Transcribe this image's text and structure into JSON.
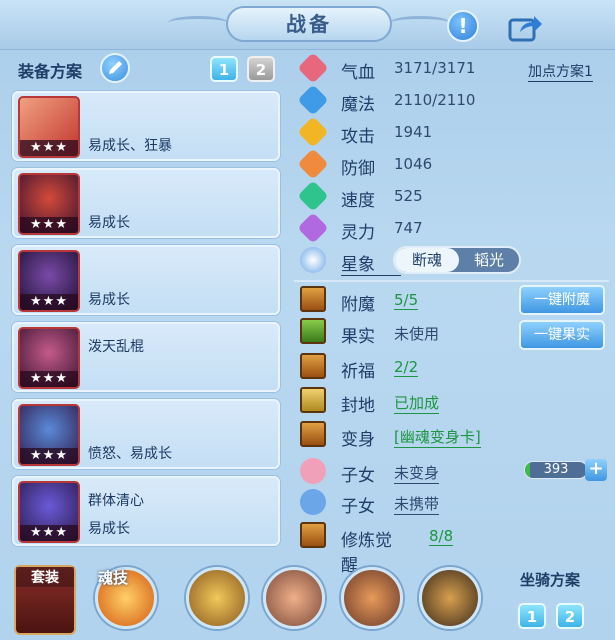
{
  "title": "战备",
  "left": {
    "plan_label": "装备方案",
    "plan_tabs": [
      "1",
      "2"
    ],
    "equipment": [
      {
        "line1": "",
        "line2": "易成长、狂暴",
        "stars": "★★★",
        "color": "#e25c3f"
      },
      {
        "line1": "",
        "line2": "易成长",
        "stars": "★★★",
        "color": "#b3364a"
      },
      {
        "line1": "",
        "line2": "易成长",
        "stars": "★★★",
        "color": "#5e2a6a"
      },
      {
        "line1": "泼天乱棍",
        "line2": "",
        "stars": "★★★",
        "color": "#7a2e56"
      },
      {
        "line1": "",
        "line2": "愤怒、易成长",
        "stars": "★★★",
        "color": "#3a5f9a"
      },
      {
        "line1": "群体清心",
        "line2": "易成长",
        "stars": "★★★",
        "color": "#4a3a9a"
      }
    ]
  },
  "stats": [
    {
      "label": "气血",
      "value": "3171/3171",
      "icon": "heart-icon",
      "color": "#e8677d"
    },
    {
      "label": "魔法",
      "value": "2110/2110",
      "icon": "mana-icon",
      "color": "#3f9be8"
    },
    {
      "label": "攻击",
      "value": "1941",
      "icon": "sword-icon",
      "color": "#f2b523"
    },
    {
      "label": "防御",
      "value": "1046",
      "icon": "shield-icon",
      "color": "#f08a3c"
    },
    {
      "label": "速度",
      "value": "525",
      "icon": "speed-icon",
      "color": "#2fc48d"
    },
    {
      "label": "灵力",
      "value": "747",
      "icon": "spirit-icon",
      "color": "#b069e0"
    }
  ],
  "add_point": "加点方案1",
  "star": {
    "label": "星象",
    "toggle_on": "断魂",
    "toggle_off": "韬光"
  },
  "features": [
    {
      "label": "附魔",
      "value": "5/5"
    },
    {
      "label": "果实",
      "value": "未使用"
    },
    {
      "label": "祈福",
      "value": "2/2"
    },
    {
      "label": "封地",
      "value": "已加成"
    },
    {
      "label": "变身",
      "value": "[幽魂变身卡]"
    },
    {
      "label": "子女",
      "value": "未变身"
    },
    {
      "label": "子女",
      "value": "未携带"
    },
    {
      "label": "修炼觉醒",
      "value": "8/8"
    }
  ],
  "buttons": {
    "enchant": "一键附魔",
    "fruit": "一键果实"
  },
  "child_progress": {
    "value": "393",
    "fraction": 0.08
  },
  "bottom": {
    "suit": "套装",
    "soul_skill": "魂技",
    "mount_label": "坐骑方案",
    "mount_tabs": [
      "1",
      "2"
    ]
  }
}
